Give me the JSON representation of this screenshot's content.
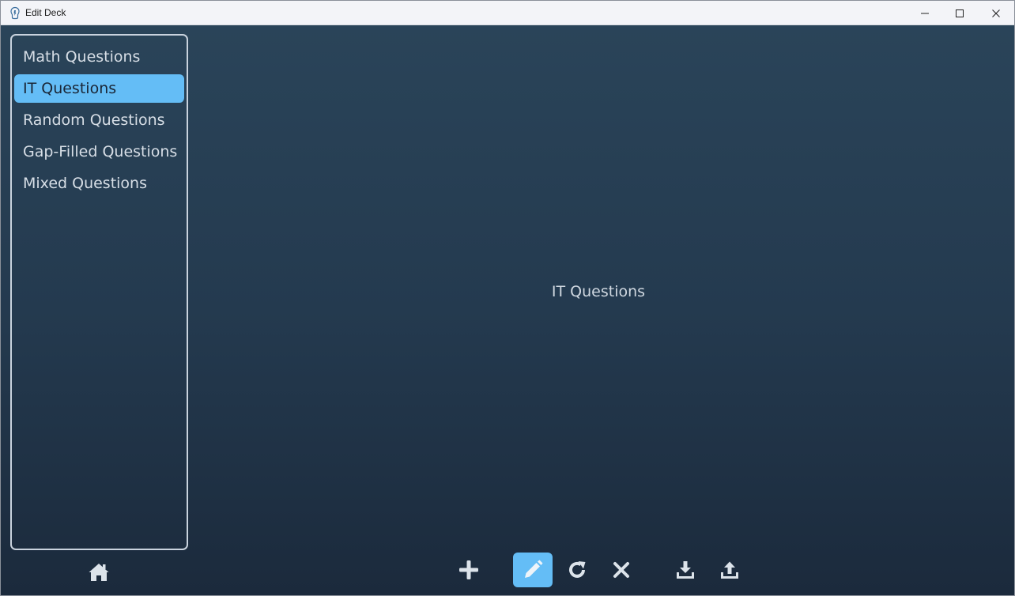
{
  "window": {
    "title": "Edit Deck"
  },
  "sidebar": {
    "items": [
      {
        "label": "Math Questions",
        "selected": false
      },
      {
        "label": "IT Questions",
        "selected": true
      },
      {
        "label": "Random Questions",
        "selected": false
      },
      {
        "label": "Gap-Filled Questions",
        "selected": false
      },
      {
        "label": "Mixed Questions",
        "selected": false
      }
    ]
  },
  "main": {
    "selected_deck_label": "IT Questions"
  },
  "toolbar": {
    "buttons": [
      {
        "icon": "plus-icon",
        "active": false
      },
      {
        "icon": "pencil-icon",
        "active": true
      },
      {
        "icon": "refresh-icon",
        "active": false
      },
      {
        "icon": "close-x-icon",
        "active": false
      },
      {
        "icon": "download-icon",
        "active": false
      },
      {
        "icon": "upload-icon",
        "active": false
      }
    ],
    "home_icon": "home-icon"
  },
  "colors": {
    "background_top": "#2a4459",
    "background_bottom": "#1b2a3c",
    "accent": "#64bdf6",
    "text": "#d7dee6",
    "icon": "#dce3ea"
  }
}
